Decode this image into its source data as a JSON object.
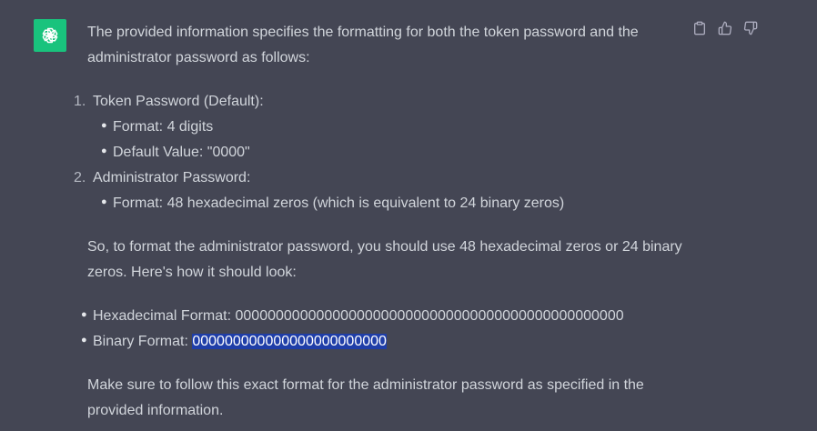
{
  "message": {
    "intro": "The provided information specifies the formatting for both the token password and the administrator password as follows:",
    "items": [
      {
        "number": "1.",
        "title": "Token Password (Default):",
        "bullets": [
          "Format: 4 digits",
          "Default Value: \"0000\""
        ]
      },
      {
        "number": "2.",
        "title": "Administrator Password:",
        "bullets": [
          "Format: 48 hexadecimal zeros (which is equivalent to 24 binary zeros)"
        ]
      }
    ],
    "para2": "So, to format the administrator password, you should use 48 hexadecimal zeros or 24 binary zeros. Here's how it should look:",
    "formats": {
      "hex_label": "Hexadecimal Format: ",
      "hex_value": "000000000000000000000000000000000000000000000000",
      "bin_label": "Binary Format: ",
      "bin_value": "000000000000000000000000"
    },
    "closing": "Make sure to follow this exact format for the administrator password as specified in the provided information."
  },
  "icons": {
    "avatar": "openai-logo-icon",
    "copy": "clipboard-icon",
    "like": "thumbs-up-icon",
    "dislike": "thumbs-down-icon"
  },
  "colors": {
    "background": "#444654",
    "avatar": "#19c37d",
    "text": "#d1d5db",
    "selection": "#1f3ea8"
  }
}
